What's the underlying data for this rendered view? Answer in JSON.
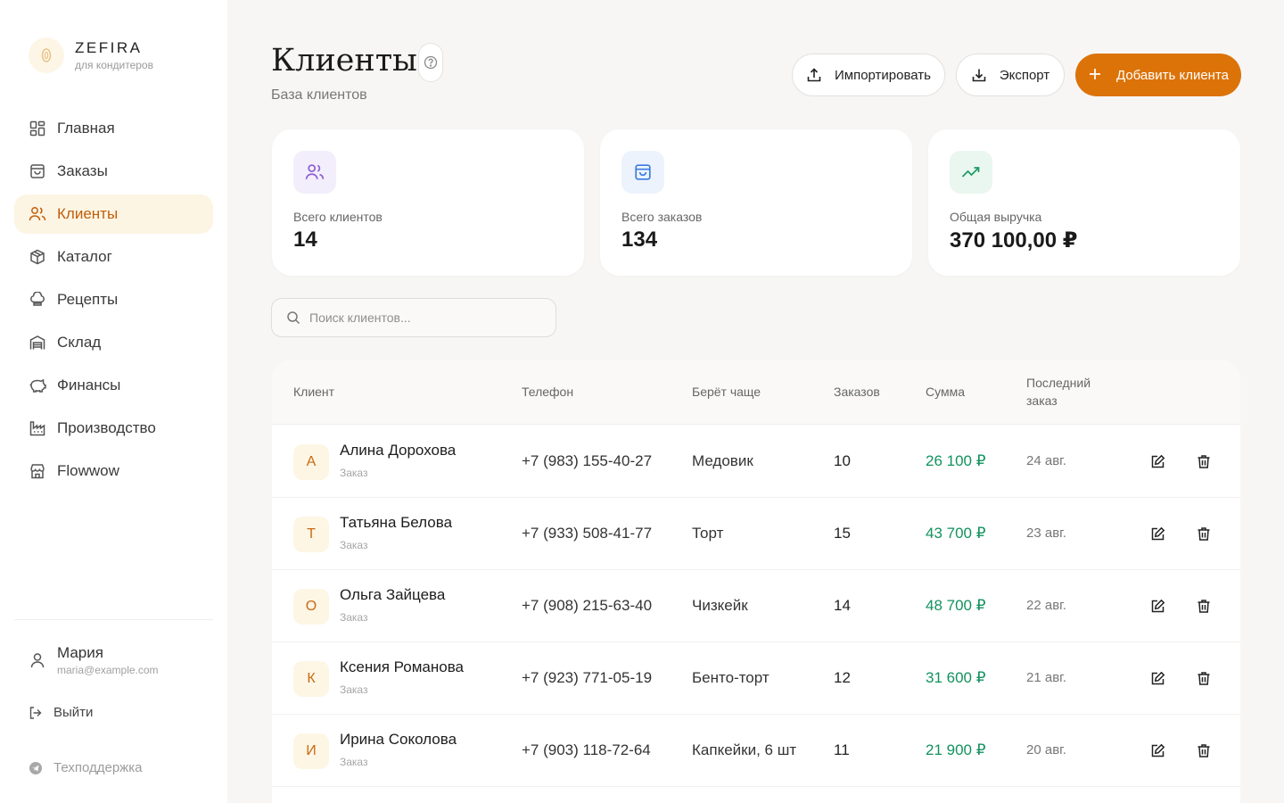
{
  "brand": {
    "name": "ZEFIRA",
    "subtitle": "для кондитеров"
  },
  "nav": [
    {
      "label": "Главная",
      "icon": "dashboard-icon"
    },
    {
      "label": "Заказы",
      "icon": "shopping-bag-icon"
    },
    {
      "label": "Клиенты",
      "icon": "users-icon",
      "active": true
    },
    {
      "label": "Каталог",
      "icon": "box-icon"
    },
    {
      "label": "Рецепты",
      "icon": "chef-hat-icon"
    },
    {
      "label": "Склад",
      "icon": "warehouse-icon"
    },
    {
      "label": "Финансы",
      "icon": "piggy-bank-icon"
    },
    {
      "label": "Производство",
      "icon": "factory-icon"
    },
    {
      "label": "Flowwow",
      "icon": "store-icon"
    }
  ],
  "user": {
    "name": "Мария",
    "email": "maria@example.com"
  },
  "logout_label": "Выйти",
  "support_label": "Техподдержка",
  "page": {
    "title": "Клиенты",
    "subtitle": "База клиентов"
  },
  "actions": {
    "import": "Импортировать",
    "export": "Экспорт",
    "add": "Добавить клиента"
  },
  "stats": [
    {
      "label": "Всего клиентов",
      "value": "14",
      "icon": "users-icon",
      "accent": "#8a5cd1"
    },
    {
      "label": "Всего заказов",
      "value": "134",
      "icon": "shopping-bag-icon",
      "accent": "#3b7be0"
    },
    {
      "label": "Общая выручка",
      "value": "370 100,00 ₽",
      "icon": "trending-up-icon",
      "accent": "#1f9a66"
    }
  ],
  "search": {
    "placeholder": "Поиск клиентов..."
  },
  "table": {
    "headers": {
      "client": "Клиент",
      "phone": "Телефон",
      "favorite": "Берёт чаще",
      "orders": "Заказов",
      "sum": "Сумма",
      "last": "Последний заказ"
    },
    "rows": [
      {
        "initial": "А",
        "name": "Алина Дорохова",
        "tag": "Заказ",
        "phone": "+7 (983) 155-40-27",
        "favorite": "Медовик",
        "orders": "10",
        "sum": "26 100 ₽",
        "last": "24 авг."
      },
      {
        "initial": "Т",
        "name": "Татьяна Белова",
        "tag": "Заказ",
        "phone": "+7 (933) 508-41-77",
        "favorite": "Торт",
        "orders": "15",
        "sum": "43 700 ₽",
        "last": "23 авг."
      },
      {
        "initial": "О",
        "name": "Ольга Зайцева",
        "tag": "Заказ",
        "phone": "+7 (908) 215-63-40",
        "favorite": "Чизкейк",
        "orders": "14",
        "sum": "48 700 ₽",
        "last": "22 авг."
      },
      {
        "initial": "К",
        "name": "Ксения Романова",
        "tag": "Заказ",
        "phone": "+7 (923) 771-05-19",
        "favorite": "Бенто-торт",
        "orders": "12",
        "sum": "31 600 ₽",
        "last": "21 авг."
      },
      {
        "initial": "И",
        "name": "Ирина Соколова",
        "tag": "Заказ",
        "phone": "+7 (903) 118-72-64",
        "favorite": "Капкейки, 6 шт",
        "orders": "11",
        "sum": "21 900 ₽",
        "last": "20 авг."
      }
    ]
  },
  "colors": {
    "accent": "#dc7309",
    "active_bg": "#fdf5e4",
    "sum": "#12925e"
  }
}
